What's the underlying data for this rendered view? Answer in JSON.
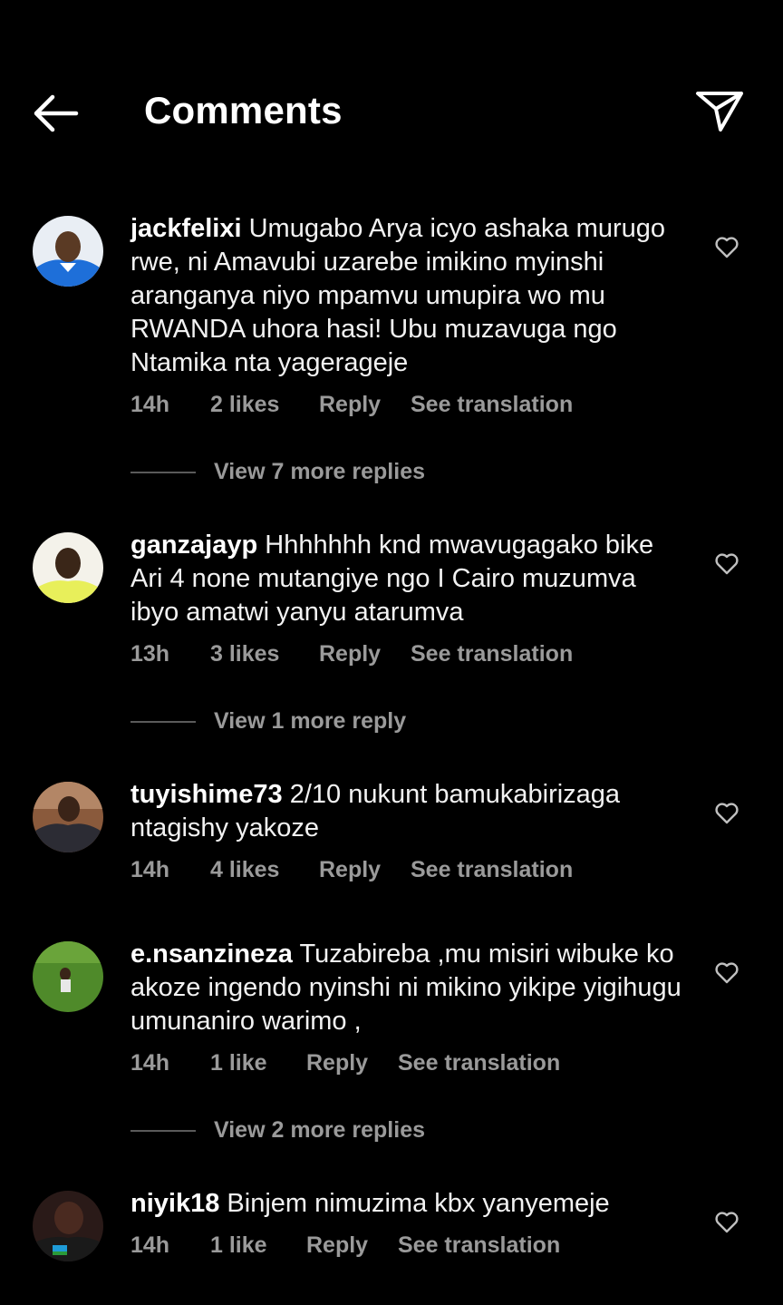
{
  "header": {
    "title": "Comments"
  },
  "comments": [
    {
      "username": "jackfelixi",
      "text": "Umugabo Arya icyo ashaka murugo rwe, ni Amavubi uzarebe imikino myinshi aranganya niyo mpamvu umupira wo mu RWANDA uhora hasi! Ubu muzavuga ngo Ntamika nta yagerageje",
      "time": "14h",
      "likes": "2 likes",
      "reply": "Reply",
      "translate": "See translation",
      "view_replies": "View 7 more replies"
    },
    {
      "username": "ganzajayp",
      "text": "Hhhhhhh knd mwavugagako bike Ari 4 none mutangiye ngo I Cairo muzumva ibyo amatwi yanyu atarumva",
      "time": "13h",
      "likes": "3 likes",
      "reply": "Reply",
      "translate": "See translation",
      "view_replies": "View 1 more reply"
    },
    {
      "username": "tuyishime73",
      "text": "2/10 nukunt bamukabirizaga ntagishy yakoze",
      "time": "14h",
      "likes": "4 likes",
      "reply": "Reply",
      "translate": "See translation"
    },
    {
      "username": "e.nsanzineza",
      "text": "Tuzabireba ,mu misiri wibuke ko akoze ingendo nyinshi ni mikino yikipe yigihugu umunaniro warimo ,",
      "time": "14h",
      "likes": "1 like",
      "reply": "Reply",
      "translate": "See translation",
      "view_replies": "View 2 more replies"
    },
    {
      "username": "niyik18",
      "text": "Binjem nimuzima kbx yanyemeje",
      "time": "14h",
      "likes": "1 like",
      "reply": "Reply",
      "translate": "See translation"
    }
  ]
}
